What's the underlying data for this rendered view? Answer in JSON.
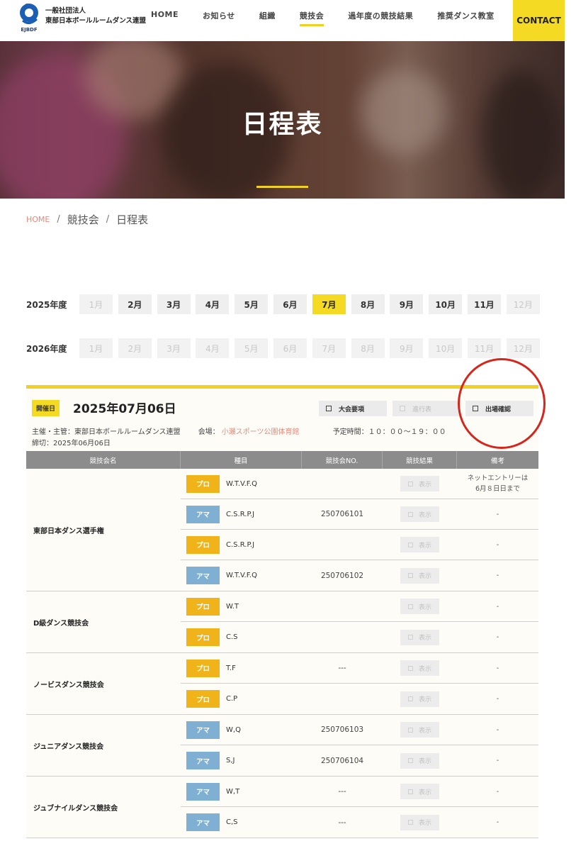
{
  "header": {
    "org_line1": "一般社団法人",
    "org_line2": "東部日本ボールルームダンス連盟",
    "logo_text": "EJBDF",
    "nav": [
      {
        "label": "HOME"
      },
      {
        "label": "お知らせ"
      },
      {
        "label": "組織"
      },
      {
        "label": "競技会"
      },
      {
        "label": "過年度の競技結果"
      },
      {
        "label": "推奨ダンス教室"
      }
    ],
    "active_nav": "競技会",
    "contact": "CONTACT"
  },
  "hero": {
    "title": "日程表"
  },
  "breadcrumb": {
    "home": "HOME",
    "sep": "/",
    "level1": "競技会",
    "level2": "日程表"
  },
  "years": [
    {
      "label": "2025年度",
      "months": [
        "1月",
        "2月",
        "3月",
        "4月",
        "5月",
        "6月",
        "7月",
        "8月",
        "9月",
        "10月",
        "11月",
        "12月"
      ],
      "active": "7月",
      "disabled": [
        "1月",
        "12月"
      ]
    },
    {
      "label": "2026年度",
      "months": [
        "1月",
        "2月",
        "3月",
        "4月",
        "5月",
        "6月",
        "7月",
        "8月",
        "9月",
        "10月",
        "11月",
        "12月"
      ],
      "active": "",
      "disabled": [
        "1月",
        "2月",
        "3月",
        "4月",
        "5月",
        "6月",
        "7月",
        "8月",
        "9月",
        "10月",
        "11月",
        "12月"
      ]
    }
  ],
  "event": {
    "badge": "開催日",
    "date": "2025年07月06日",
    "buttons": {
      "guidelines": "大会要項",
      "progress": "進行表",
      "entry_check": "出場確認"
    },
    "organizer": "主催・主管：東部日本ボールルームダンス連盟",
    "venue_label": "会場：",
    "venue": "小瀬スポーツ公園体育館",
    "time": "予定時間：１０：００〜１９：００",
    "deadline": "締切：2025年06月06日"
  },
  "table": {
    "headers": [
      "競技会名",
      "種目",
      "競技会NO.",
      "競技結果",
      "備考"
    ],
    "show_label": "表示",
    "groups": [
      {
        "name": "東部日本ダンス選手権",
        "rows": [
          {
            "type": "プロ",
            "kind": "pro",
            "event": "W.T.V.F.Q",
            "no": "",
            "note1": "ネットエントリーは",
            "note2": "6月８日日まで"
          },
          {
            "type": "アマ",
            "kind": "ama",
            "event": "C.S.R.P.J",
            "no": "250706101",
            "note1": "-",
            "note2": ""
          },
          {
            "type": "プロ",
            "kind": "pro",
            "event": "C.S.R.P.J",
            "no": "",
            "note1": "-",
            "note2": ""
          },
          {
            "type": "アマ",
            "kind": "ama",
            "event": "W.T.V.F.Q",
            "no": "250706102",
            "note1": "-",
            "note2": ""
          }
        ]
      },
      {
        "name": "D級ダンス競技会",
        "rows": [
          {
            "type": "プロ",
            "kind": "pro",
            "event": "W.T",
            "no": "",
            "note1": "-",
            "note2": ""
          },
          {
            "type": "プロ",
            "kind": "pro",
            "event": "C.S",
            "no": "",
            "note1": "-",
            "note2": ""
          }
        ]
      },
      {
        "name": "ノービスダンス競技会",
        "rows": [
          {
            "type": "プロ",
            "kind": "pro",
            "event": "T.F",
            "no": "---",
            "note1": "-",
            "note2": ""
          },
          {
            "type": "プロ",
            "kind": "pro",
            "event": "C.P",
            "no": "",
            "note1": "-",
            "note2": ""
          }
        ]
      },
      {
        "name": "ジュニアダンス競技会",
        "rows": [
          {
            "type": "アマ",
            "kind": "ama",
            "event": "W,Q",
            "no": "250706103",
            "note1": "-",
            "note2": ""
          },
          {
            "type": "アマ",
            "kind": "ama",
            "event": "S,J",
            "no": "250706104",
            "note1": "-",
            "note2": ""
          }
        ]
      },
      {
        "name": "ジュブナイルダンス競技会",
        "rows": [
          {
            "type": "アマ",
            "kind": "ama",
            "event": "W,T",
            "no": "---",
            "note1": "-",
            "note2": ""
          },
          {
            "type": "アマ",
            "kind": "ama",
            "event": "C,S",
            "no": "---",
            "note1": "-",
            "note2": ""
          }
        ]
      }
    ]
  },
  "colors": {
    "accent_yellow": "#f5da24",
    "pro_tag": "#f0b41a",
    "ama_tag": "#7fb0d3",
    "annotation_red": "#d6261c",
    "link_salmon": "#e88a7a"
  }
}
